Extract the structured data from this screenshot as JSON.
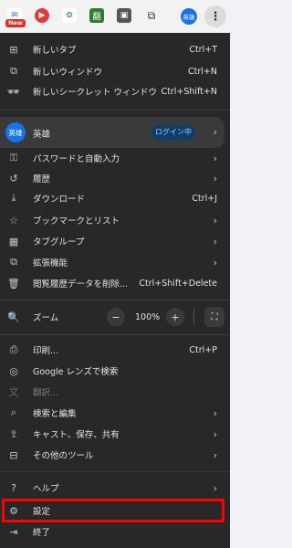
{
  "toolbar": {
    "new_badge": "New",
    "profile_avatar_text": "英雄",
    "kebab_label": "⋮"
  },
  "menu": {
    "new_tab": {
      "label": "新しいタブ",
      "shortcut": "Ctrl+T"
    },
    "new_window": {
      "label": "新しいウィンドウ",
      "shortcut": "Ctrl+N"
    },
    "incognito": {
      "label": "新しいシークレット ウィンドウ",
      "shortcut": "Ctrl+Shift+N"
    },
    "profile": {
      "avatar": "英雄",
      "name": "英雄",
      "status": "ログイン中"
    },
    "passwords": {
      "label": "パスワードと自動入力"
    },
    "history": {
      "label": "履歴"
    },
    "downloads": {
      "label": "ダウンロード",
      "shortcut": "Ctrl+J"
    },
    "bookmarks": {
      "label": "ブックマークとリスト"
    },
    "tab_groups": {
      "label": "タブグループ"
    },
    "extensions": {
      "label": "拡張機能"
    },
    "clear_data": {
      "label": "閲覧履歴データを削除...",
      "shortcut": "Ctrl+Shift+Delete"
    },
    "zoom": {
      "label": "ズーム",
      "minus": "−",
      "value": "100%",
      "plus": "+"
    },
    "print": {
      "label": "印刷...",
      "shortcut": "Ctrl+P"
    },
    "google_lens": {
      "label": "Google レンズで検索"
    },
    "translate": {
      "label": "翻訳..."
    },
    "find_edit": {
      "label": "検索と編集"
    },
    "cast_save_share": {
      "label": "キャスト、保存、共有"
    },
    "more_tools": {
      "label": "その他のツール"
    },
    "help": {
      "label": "ヘルプ"
    },
    "settings": {
      "label": "設定"
    },
    "exit": {
      "label": "終了"
    }
  },
  "colors": {
    "menu_bg": "#282828",
    "accent": "#1a73e8",
    "highlight": "#ff0000"
  }
}
